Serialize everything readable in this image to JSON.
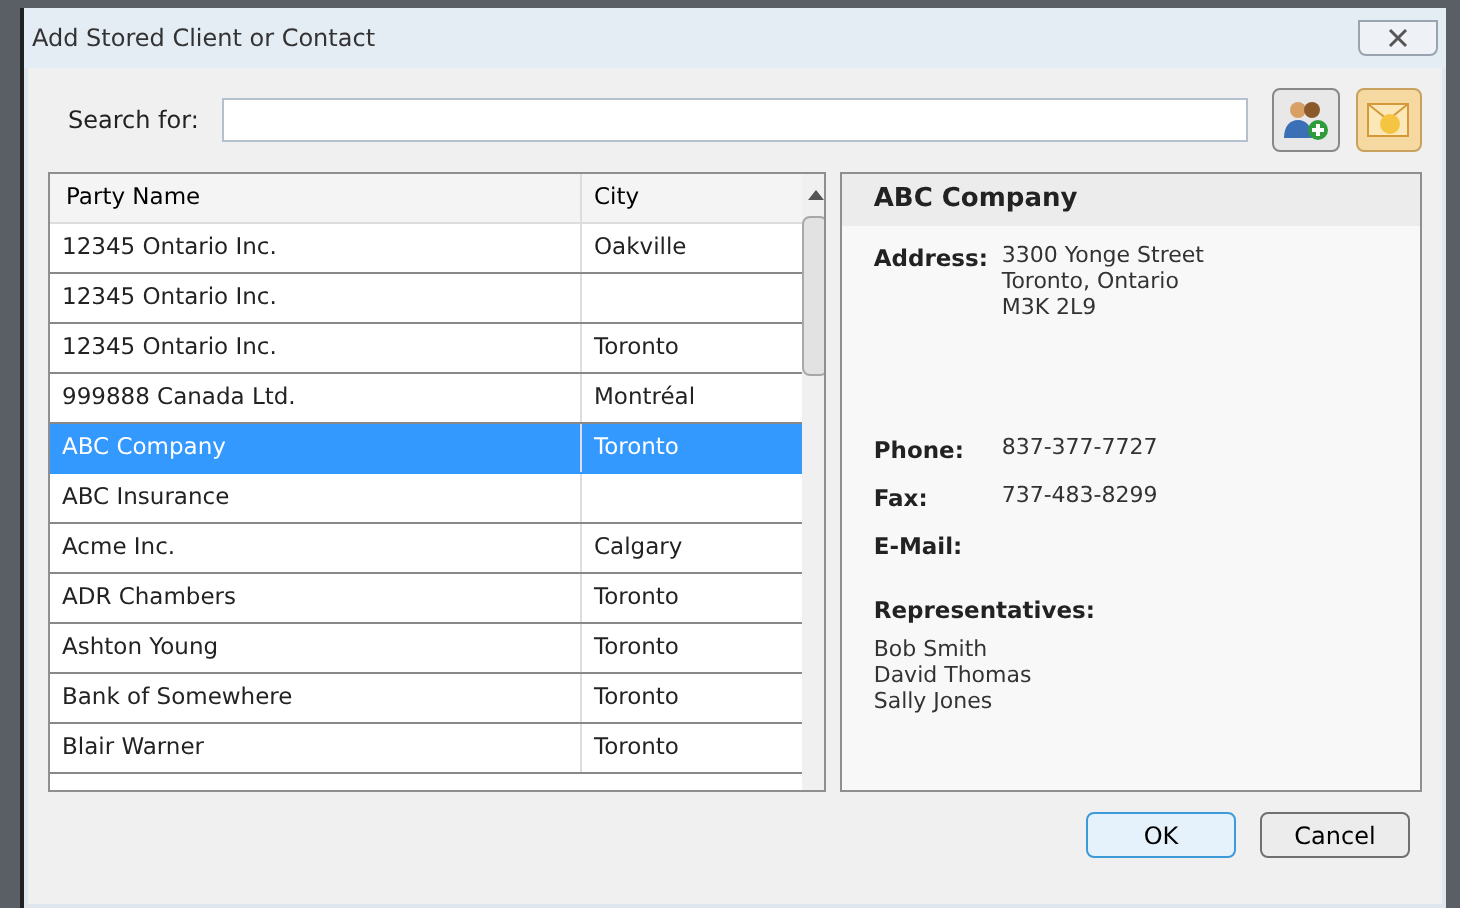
{
  "window": {
    "title": "Add Stored Client or Contact"
  },
  "search": {
    "label": "Search for:"
  },
  "table": {
    "columns": [
      "Party Name",
      "City"
    ],
    "rows": [
      {
        "name": "12345 Ontario Inc.",
        "city": "Oakville",
        "selected": false
      },
      {
        "name": "12345 Ontario Inc.",
        "city": "",
        "selected": false
      },
      {
        "name": "12345 Ontario Inc.",
        "city": "Toronto",
        "selected": false
      },
      {
        "name": "999888 Canada Ltd.",
        "city": "Montréal",
        "selected": false
      },
      {
        "name": "ABC Company",
        "city": "Toronto",
        "selected": true
      },
      {
        "name": "ABC Insurance",
        "city": "",
        "selected": false
      },
      {
        "name": "Acme Inc.",
        "city": "Calgary",
        "selected": false
      },
      {
        "name": "ADR Chambers",
        "city": "Toronto",
        "selected": false
      },
      {
        "name": "Ashton Young",
        "city": "Toronto",
        "selected": false
      },
      {
        "name": "Bank of Somewhere",
        "city": "Toronto",
        "selected": false
      },
      {
        "name": "Blair Warner",
        "city": "Toronto",
        "selected": false
      }
    ]
  },
  "details": {
    "title": "ABC Company",
    "fields": [
      {
        "label": "Address:",
        "lines": [
          "3300 Yonge Street",
          "Toronto, Ontario",
          "M3K 2L9"
        ]
      },
      {
        "label": "Phone:",
        "lines": [
          "837-377-7727"
        ]
      },
      {
        "label": "Fax:",
        "lines": [
          "737-483-8299"
        ]
      },
      {
        "label": "E-Mail:"
      }
    ],
    "representatives_label": "Representatives:",
    "representatives": [
      "Bob Smith",
      "David Thomas",
      "Sally Jones"
    ]
  },
  "buttons": [
    "OK",
    "Cancel"
  ]
}
